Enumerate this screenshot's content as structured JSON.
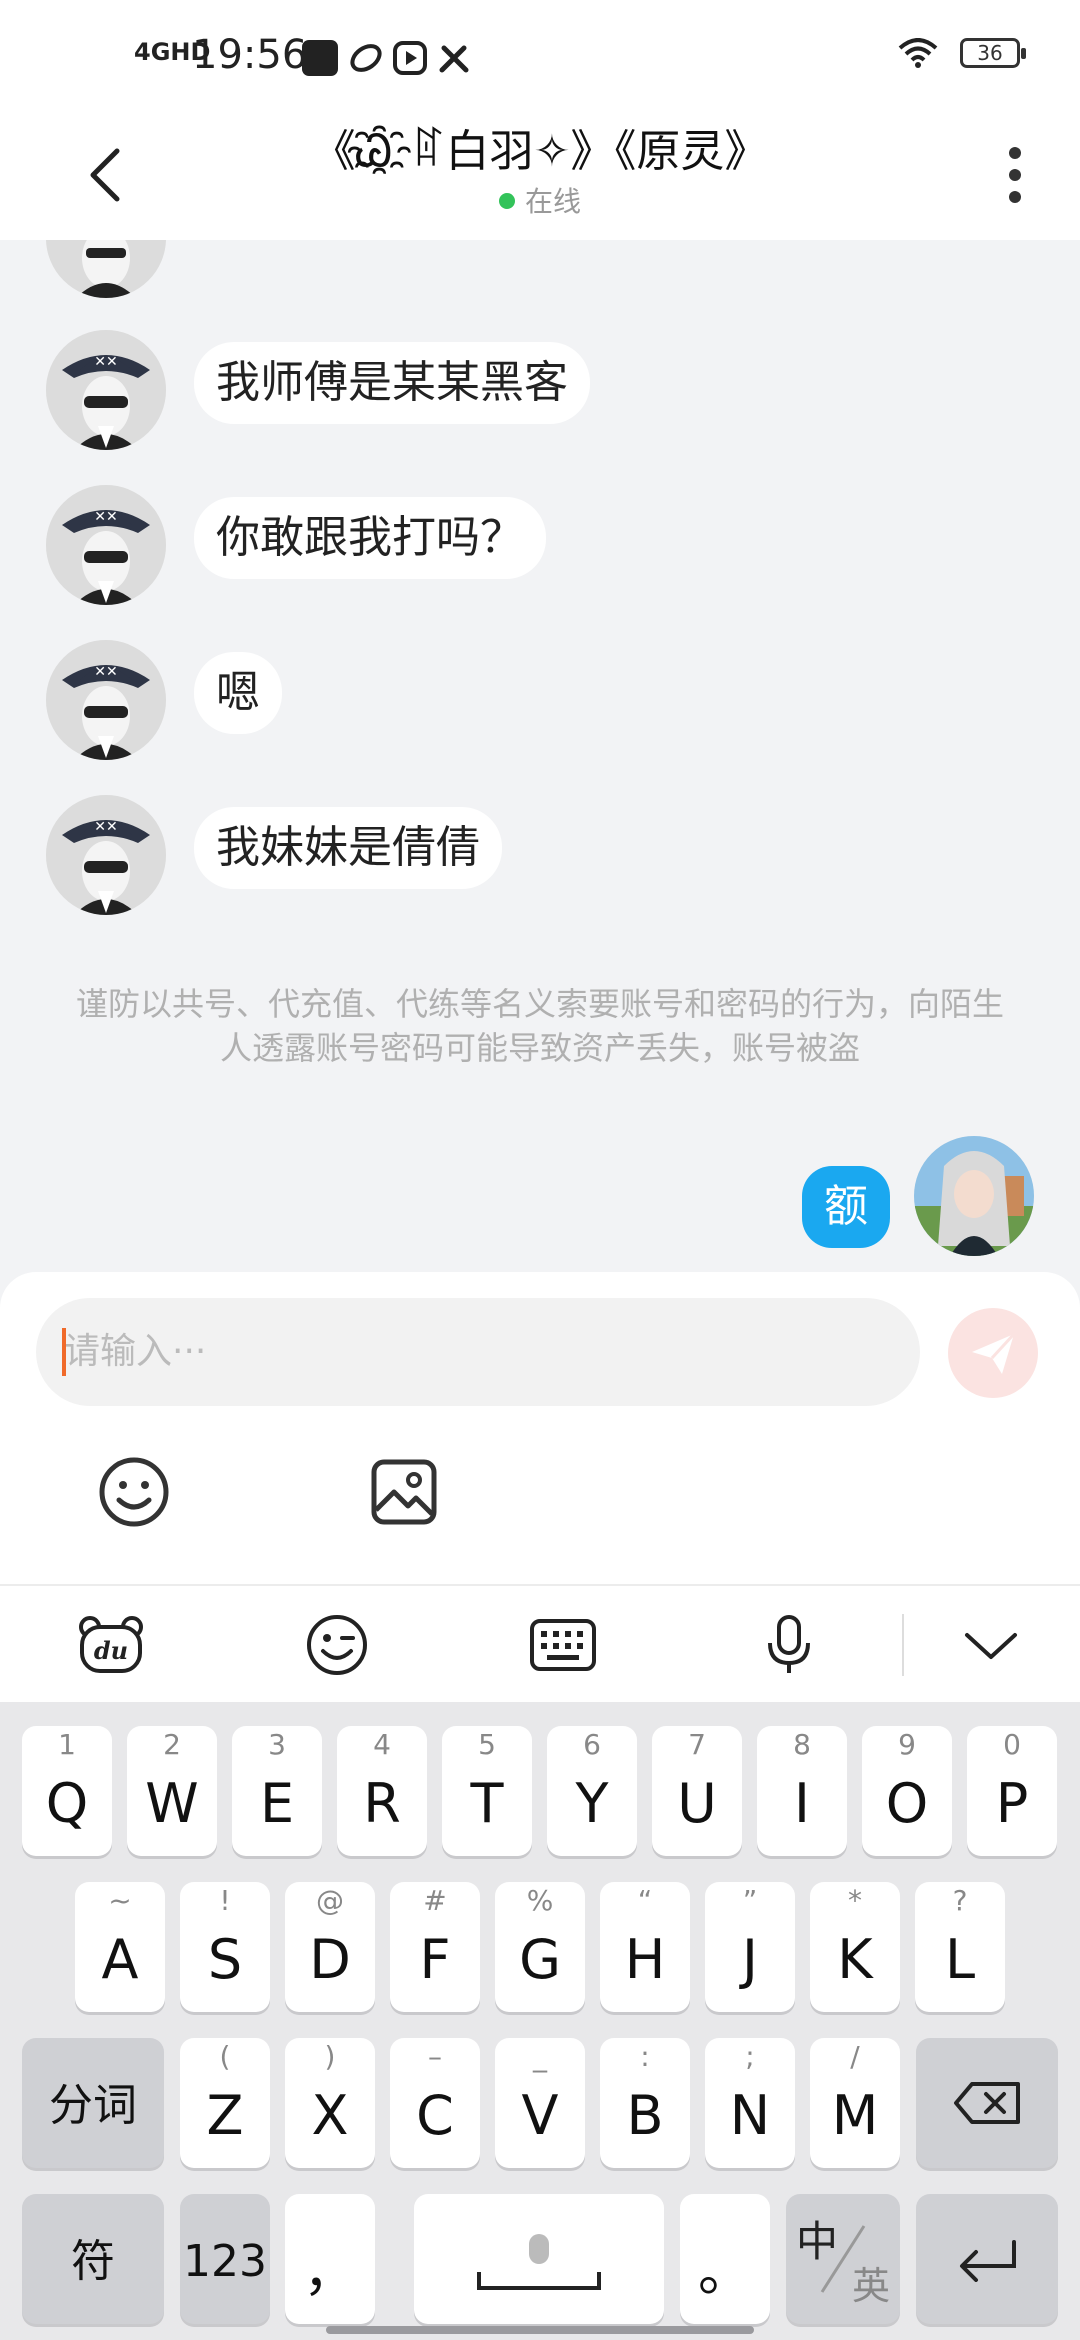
{
  "status_bar": {
    "network": "4GHD",
    "time": "19:56",
    "battery": "36"
  },
  "header": {
    "title": "《Ꮚ҈ꍏ白羽✧》《原灵》",
    "status": "在线"
  },
  "messages": [
    {
      "text": "我师傅是某某黑客"
    },
    {
      "text": "你敢跟我打吗？"
    },
    {
      "text": "嗯"
    },
    {
      "text": "我妹妹是倩倩"
    }
  ],
  "notice": "谨防以共号、代充值、代练等名义索要账号和密码的行为，向陌生人透露账号密码可能导致资产丢失，账号被盗",
  "my_message": "额",
  "input": {
    "placeholder": "请输入···"
  },
  "keyboard": {
    "row1": [
      {
        "hint": "1",
        "key": "Q"
      },
      {
        "hint": "2",
        "key": "W"
      },
      {
        "hint": "3",
        "key": "E"
      },
      {
        "hint": "4",
        "key": "R"
      },
      {
        "hint": "5",
        "key": "T"
      },
      {
        "hint": "6",
        "key": "Y"
      },
      {
        "hint": "7",
        "key": "U"
      },
      {
        "hint": "8",
        "key": "I"
      },
      {
        "hint": "9",
        "key": "O"
      },
      {
        "hint": "0",
        "key": "P"
      }
    ],
    "row2": [
      {
        "hint": "~",
        "key": "A"
      },
      {
        "hint": "!",
        "key": "S"
      },
      {
        "hint": "@",
        "key": "D"
      },
      {
        "hint": "#",
        "key": "F"
      },
      {
        "hint": "%",
        "key": "G"
      },
      {
        "hint": "“",
        "key": "H"
      },
      {
        "hint": "”",
        "key": "J"
      },
      {
        "hint": "*",
        "key": "K"
      },
      {
        "hint": "?",
        "key": "L"
      }
    ],
    "row3": [
      {
        "hint": "(",
        "key": "Z"
      },
      {
        "hint": ")",
        "key": "X"
      },
      {
        "hint": "–",
        "key": "C"
      },
      {
        "hint": "_",
        "key": "V"
      },
      {
        "hint": ":",
        "key": "B"
      },
      {
        "hint": ";",
        "key": "N"
      },
      {
        "hint": "/",
        "key": "M"
      }
    ],
    "segment_key": "分词",
    "symbol_key": "符",
    "number_key": "123",
    "comma_key": "，",
    "period_key": "。",
    "lang_cn": "中",
    "lang_en": "英"
  },
  "colors": {
    "accent_blue": "#1aa8f0",
    "online_green": "#33c35a",
    "caret_orange": "#f06a2a"
  }
}
